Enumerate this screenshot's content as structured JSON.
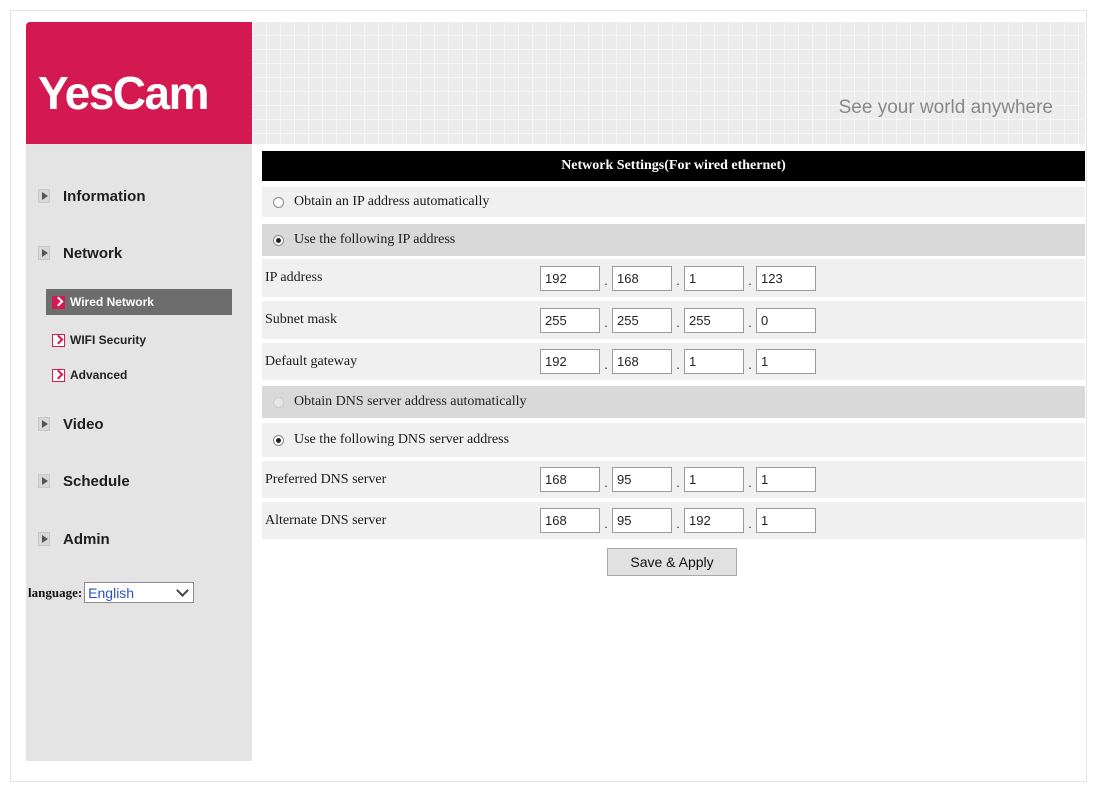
{
  "header": {
    "logo_text": "YesCam",
    "tagline": "See your world anywhere",
    "brand_color": "#d3194f"
  },
  "sidebar": {
    "items": [
      {
        "label": "Information",
        "icon": "triangle-right-icon"
      },
      {
        "label": "Network",
        "icon": "triangle-right-icon"
      },
      {
        "label": "Video",
        "icon": "triangle-right-icon"
      },
      {
        "label": "Schedule",
        "icon": "triangle-right-icon"
      },
      {
        "label": "Admin",
        "icon": "triangle-right-icon"
      }
    ],
    "network_subitems": [
      {
        "label": "Wired Network",
        "active": true,
        "icon": "arrow-right-icon"
      },
      {
        "label": "WIFI Security",
        "active": false,
        "icon": "arrow-right-icon"
      },
      {
        "label": "Advanced",
        "active": false,
        "icon": "arrow-right-icon"
      }
    ],
    "language_label": "language:",
    "language_value": "English"
  },
  "main": {
    "title": "Network Settings(For wired ethernet)",
    "ip_auto_label": "Obtain an IP address automatically",
    "ip_manual_label": "Use the following IP address",
    "ip_mode": "manual",
    "fields": {
      "ip_address": {
        "label": "IP address",
        "octets": [
          "192",
          "168",
          "1",
          "123"
        ]
      },
      "subnet_mask": {
        "label": "Subnet mask",
        "octets": [
          "255",
          "255",
          "255",
          "0"
        ]
      },
      "default_gateway": {
        "label": "Default gateway",
        "octets": [
          "192",
          "168",
          "1",
          "1"
        ]
      },
      "preferred_dns": {
        "label": "Preferred DNS server",
        "octets": [
          "168",
          "95",
          "1",
          "1"
        ]
      },
      "alternate_dns": {
        "label": "Alternate DNS server",
        "octets": [
          "168",
          "95",
          "192",
          "1"
        ]
      }
    },
    "dns_auto_label": "Obtain DNS server address automatically",
    "dns_manual_label": "Use the following DNS server address",
    "dns_mode": "manual",
    "save_label": "Save & Apply"
  }
}
